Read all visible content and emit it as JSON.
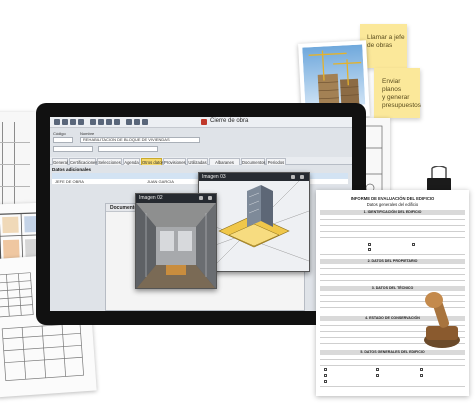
{
  "notes": {
    "note1": [
      "Llamar a jefe",
      "de obras"
    ],
    "note2": [
      "Enviar planos",
      "y generar",
      "presupuestos"
    ]
  },
  "app": {
    "window_title": "Cierre de obra",
    "fields": {
      "codigo_label": "Código",
      "nombre_label": "Nombre",
      "nombre_value": "REHABILITACION DE BLOQUE DE VIVIENDAS"
    },
    "tabs": [
      "General",
      "Certificaciones",
      "Selecciones",
      "Agenda",
      "Otros datos",
      "Provisiones",
      "Utilizadas",
      "Albaranes",
      "Documentos",
      "Periodos"
    ],
    "active_tab": 4,
    "section_title": "Datos adicionales",
    "grid_row": [
      "JEFE DE OBRA",
      "JUAN GARCIA"
    ],
    "documents_label": "Documentos"
  },
  "image_windows": {
    "front_title": "Imagen 02",
    "back_title": "Imagen 03"
  },
  "report": {
    "title": "INFORME DE EVALUACIÓN DEL EDIFICIO",
    "subtitle": "Datos generales del edificio",
    "sections": [
      "1. IDENTIFICACIÓN DEL EDIFICIO",
      "2. DATOS DEL PROPIETARIO",
      "3. DATOS DEL TÉCNICO",
      "4. ESTADO DE CONSERVACIÓN",
      "5. DATOS GENERALES DEL EDIFICIO"
    ]
  },
  "colors": {
    "note": "#fbe89a",
    "active_tab": "#f5d96e",
    "laptop": "#111111",
    "grid_head": "#d3e3f3"
  }
}
